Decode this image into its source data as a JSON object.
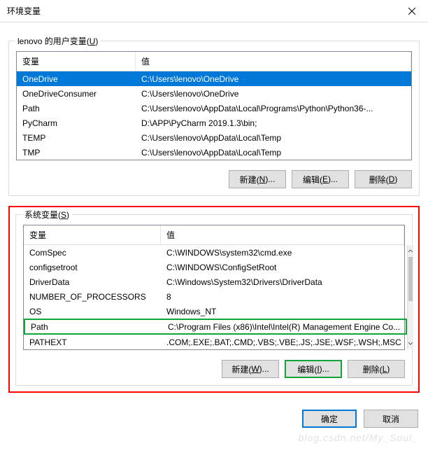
{
  "window": {
    "title": "环境变量"
  },
  "user_section": {
    "label_prefix": "lenovo 的用户变量(",
    "label_hotkey": "U",
    "label_suffix": ")",
    "columns": {
      "variable": "变量",
      "value": "值"
    },
    "rows": [
      {
        "name": "OneDrive",
        "value": "C:\\Users\\lenovo\\OneDrive",
        "selected": true
      },
      {
        "name": "OneDriveConsumer",
        "value": "C:\\Users\\lenovo\\OneDrive"
      },
      {
        "name": "Path",
        "value": "C:\\Users\\lenovo\\AppData\\Local\\Programs\\Python\\Python36-..."
      },
      {
        "name": "PyCharm",
        "value": "D:\\APP\\PyCharm 2019.1.3\\bin;"
      },
      {
        "name": "TEMP",
        "value": "C:\\Users\\lenovo\\AppData\\Local\\Temp"
      },
      {
        "name": "TMP",
        "value": "C:\\Users\\lenovo\\AppData\\Local\\Temp"
      }
    ],
    "buttons": {
      "new_prefix": "新建(",
      "new_hk": "N",
      "new_suffix": ")...",
      "edit_prefix": "编辑(",
      "edit_hk": "E",
      "edit_suffix": ")...",
      "del_prefix": "删除(",
      "del_hk": "D",
      "del_suffix": ")"
    }
  },
  "system_section": {
    "label_prefix": "系统变量(",
    "label_hotkey": "S",
    "label_suffix": ")",
    "columns": {
      "variable": "变量",
      "value": "值"
    },
    "rows": [
      {
        "name": "ComSpec",
        "value": "C:\\WINDOWS\\system32\\cmd.exe"
      },
      {
        "name": "configsetroot",
        "value": "C:\\WINDOWS\\ConfigSetRoot"
      },
      {
        "name": "DriverData",
        "value": "C:\\Windows\\System32\\Drivers\\DriverData"
      },
      {
        "name": "NUMBER_OF_PROCESSORS",
        "value": "8"
      },
      {
        "name": "OS",
        "value": "Windows_NT"
      },
      {
        "name": "Path",
        "value": "C:\\Program Files (x86)\\Intel\\Intel(R) Management Engine Co...",
        "highlight": true
      },
      {
        "name": "PATHEXT",
        "value": ".COM;.EXE;.BAT;.CMD;.VBS;.VBE;.JS;.JSE;.WSF;.WSH;.MSC"
      }
    ],
    "buttons": {
      "new_prefix": "新建(",
      "new_hk": "W",
      "new_suffix": ")...",
      "edit_prefix": "编辑(",
      "edit_hk": "I",
      "edit_suffix": ")...",
      "del_prefix": "删除(",
      "del_hk": "L",
      "del_suffix": ")"
    }
  },
  "footer": {
    "ok": "确定",
    "cancel": "取消"
  },
  "watermark": "blog.csdn.net/My_Soul_"
}
